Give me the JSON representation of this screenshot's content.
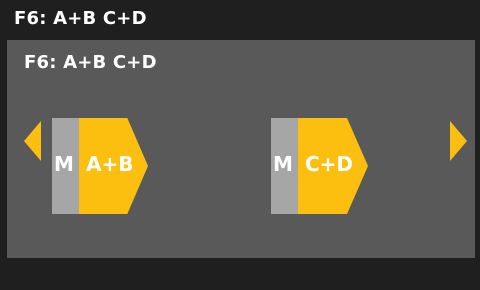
{
  "header": {
    "title": "F6: A+B  C+D"
  },
  "panel": {
    "title": "F6:  A+B  C+D",
    "modes": [
      {
        "memory_label": "M",
        "label": "A+B"
      },
      {
        "memory_label": "M",
        "label": "C+D"
      }
    ]
  },
  "navigation": {
    "previous_icon": "triangle-left",
    "next_icon": "triangle-right"
  },
  "colors": {
    "accent": "#fcbf10",
    "memory_block": "#a6a6a6",
    "panel_background": "#595959",
    "bar_background": "#1f1f1f",
    "text": "#ffffff"
  }
}
